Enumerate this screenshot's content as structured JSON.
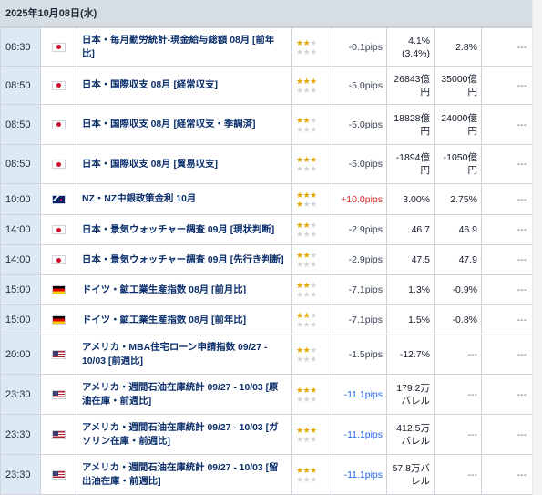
{
  "header": {
    "date": "2025年10月08日(水)"
  },
  "none_label": "---",
  "rows": [
    {
      "time": "08:30",
      "country": "japan-flag-icon",
      "flag": "jp",
      "event": "日本・毎月勤労統計-現金給与総額 08月 [前年比]",
      "stars": 2,
      "diff": "-0.1pips",
      "diff_sign": "",
      "result": "4.1% (3.4%)",
      "forecast": "2.8%",
      "actual": "---",
      "h": 42
    },
    {
      "time": "08:50",
      "country": "japan-flag-icon",
      "flag": "jp",
      "event": "日本・国際収支 08月 [経常収支]",
      "stars": 3,
      "diff": "-5.0pips",
      "diff_sign": "",
      "result": "26843億円",
      "forecast": "35000億円",
      "actual": "---",
      "h": 42
    },
    {
      "time": "08:50",
      "country": "japan-flag-icon",
      "flag": "jp",
      "event": "日本・国際収支 08月 [経常収支・季調済]",
      "stars": 2,
      "diff": "-5.0pips",
      "diff_sign": "",
      "result": "18828億円",
      "forecast": "24000億円",
      "actual": "---",
      "h": 44
    },
    {
      "time": "08:50",
      "country": "japan-flag-icon",
      "flag": "jp",
      "event": "日本・国際収支 08月 [貿易収支]",
      "stars": 3,
      "diff": "-5.0pips",
      "diff_sign": "",
      "result": "-1894億円",
      "forecast": "-1050億円",
      "actual": "---",
      "h": 43
    },
    {
      "time": "10:00",
      "country": "new-zealand-flag-icon",
      "flag": "nz",
      "event": "NZ・NZ中銀政策金利 10月",
      "stars": 4,
      "diff": "+10.0pips",
      "diff_sign": "pos",
      "result": "3.00%",
      "forecast": "2.75%",
      "actual": "---",
      "h": 34
    },
    {
      "time": "14:00",
      "country": "japan-flag-icon",
      "flag": "jp",
      "event": "日本・景気ウォッチャー調査 09月 [現状判断]",
      "stars": 2,
      "diff": "-2.9pips",
      "diff_sign": "",
      "result": "46.7",
      "forecast": "46.9",
      "actual": "---",
      "h": 33
    },
    {
      "time": "14:00",
      "country": "japan-flag-icon",
      "flag": "jp",
      "event": "日本・景気ウォッチャー調査 09月 [先行き判断]",
      "stars": 2,
      "diff": "-2.9pips",
      "diff_sign": "",
      "result": "47.5",
      "forecast": "47.9",
      "actual": "---",
      "h": 33
    },
    {
      "time": "15:00",
      "country": "germany-flag-icon",
      "flag": "de",
      "event": "ドイツ・鉱工業生産指数 08月 [前月比]",
      "stars": 2,
      "diff": "-7.1pips",
      "diff_sign": "",
      "result": "1.3%",
      "forecast": "-0.9%",
      "actual": "---",
      "h": 33
    },
    {
      "time": "15:00",
      "country": "germany-flag-icon",
      "flag": "de",
      "event": "ドイツ・鉱工業生産指数 08月 [前年比]",
      "stars": 2,
      "diff": "-7.1pips",
      "diff_sign": "",
      "result": "1.5%",
      "forecast": "-0.8%",
      "actual": "---",
      "h": 33
    },
    {
      "time": "20:00",
      "country": "usa-flag-icon",
      "flag": "us",
      "event": "アメリカ・MBA住宅ローン申請指数 09/27 - 10/03 [前週比]",
      "stars": 2,
      "diff": "-1.5pips",
      "diff_sign": "",
      "result": "-12.7%",
      "forecast": "---",
      "actual": "---",
      "h": 43
    },
    {
      "time": "23:30",
      "country": "usa-flag-icon",
      "flag": "us",
      "event": "アメリカ・週間石油在庫統計 09/27 - 10/03 [原油在庫・前週比]",
      "stars": 3,
      "diff": "-11.1pips",
      "diff_sign": "neg",
      "result": "179.2万バレル",
      "forecast": "---",
      "actual": "---",
      "h": 44
    },
    {
      "time": "23:30",
      "country": "usa-flag-icon",
      "flag": "us",
      "event": "アメリカ・週間石油在庫統計 09/27 - 10/03 [ガソリン在庫・前週比]",
      "stars": 3,
      "diff": "-11.1pips",
      "diff_sign": "neg",
      "result": "412.5万バレル",
      "forecast": "---",
      "actual": "---",
      "h": 44
    },
    {
      "time": "23:30",
      "country": "usa-flag-icon",
      "flag": "us",
      "event": "アメリカ・週間石油在庫統計 09/27 - 10/03 [留出油在庫・前週比]",
      "stars": 3,
      "diff": "-11.1pips",
      "diff_sign": "neg",
      "result": "57.8万バレル",
      "forecast": "---",
      "actual": "---",
      "h": 44
    }
  ]
}
